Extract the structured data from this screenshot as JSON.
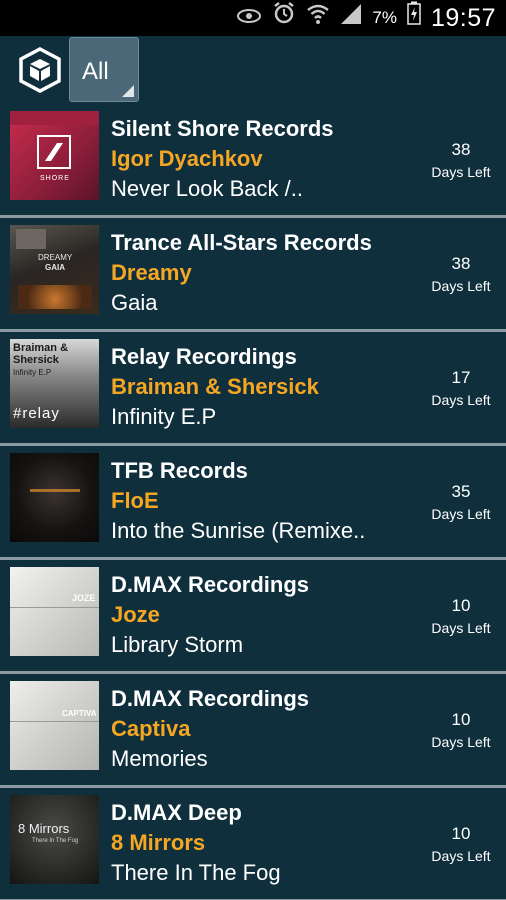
{
  "status_bar": {
    "icons": [
      "eye-icon",
      "alarm-icon",
      "wifi-icon",
      "signal-icon"
    ],
    "battery_percent": "7%",
    "time": "19:57"
  },
  "toolbar": {
    "filter_label": "All"
  },
  "releases": [
    {
      "label": "Silent Shore Records",
      "artist": "Igor Dyachkov",
      "title": "Never Look Back /..",
      "days": "38",
      "days_text": "Days Left"
    },
    {
      "label": "Trance All-Stars Records",
      "artist": "Dreamy",
      "title": "Gaia",
      "days": "38",
      "days_text": "Days Left"
    },
    {
      "label": "Relay Recordings",
      "artist": "Braiman & Shersick",
      "title": "Infinity E.P",
      "days": "17",
      "days_text": "Days Left"
    },
    {
      "label": "TFB Records",
      "artist": "FloE",
      "title": "Into the Sunrise (Remixe..",
      "days": "35",
      "days_text": "Days Left"
    },
    {
      "label": "D.MAX Recordings",
      "artist": "Joze",
      "title": "Library Storm",
      "days": "10",
      "days_text": "Days Left"
    },
    {
      "label": "D.MAX Recordings",
      "artist": "Captiva",
      "title": "Memories",
      "days": "10",
      "days_text": "Days Left"
    },
    {
      "label": "D.MAX Deep",
      "artist": "8 Mirrors",
      "title": "There In The Fog",
      "days": "10",
      "days_text": "Days Left"
    }
  ],
  "artwork": {
    "shore": "SHORE",
    "dreamy": "DREAMY",
    "gaia": "GAIA",
    "braiman": "Braiman &",
    "shersick": "Shersick",
    "infinity": "Infinity E.P",
    "relay": "#relay",
    "joze": "JOZE",
    "captiva": "CAPTIVA",
    "mirrors": "8 Mirrors",
    "fog": "There In The Fog"
  },
  "colors": {
    "background": "#0f2f3d",
    "artist": "#f5a623",
    "divider": "#8c9aa1",
    "filter_button": "#4a6878"
  }
}
